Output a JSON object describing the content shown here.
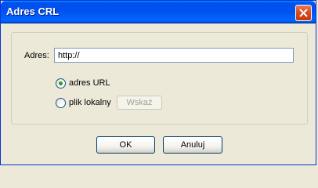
{
  "window": {
    "title": "Adres CRL",
    "icon": "close-icon"
  },
  "address": {
    "label": "Adres:",
    "value": "http://"
  },
  "source": {
    "options": [
      {
        "label": "adres URL",
        "checked": true
      },
      {
        "label": "plik lokalny",
        "checked": false
      }
    ],
    "browse_label": "Wskaż",
    "browse_enabled": false
  },
  "buttons": {
    "ok": "OK",
    "cancel": "Anuluj"
  }
}
